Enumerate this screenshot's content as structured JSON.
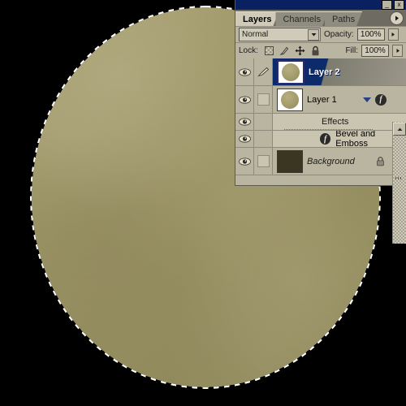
{
  "window": {
    "minimize_label": "_",
    "close_label": "x"
  },
  "palette": {
    "tabs": [
      {
        "label": "Layers",
        "active": true
      },
      {
        "label": "Channels",
        "active": false
      },
      {
        "label": "Paths",
        "active": false
      }
    ],
    "menu_icon": "palette-menu-arrow-icon",
    "blend_mode": {
      "value": "Normal",
      "dropdown_icon": "chevron-down-icon"
    },
    "opacity": {
      "label": "Opacity:",
      "value": "100%",
      "spinner_icon": "spinner-arrow-icon"
    },
    "fill": {
      "label": "Fill:",
      "value": "100%",
      "spinner_icon": "spinner-arrow-icon"
    },
    "lock": {
      "label": "Lock:",
      "icons": [
        "lock-transparent-pixels-icon",
        "lock-image-pixels-icon",
        "lock-position-icon",
        "lock-all-icon"
      ]
    },
    "layers": [
      {
        "name": "Layer 2",
        "selected": true,
        "visible": true,
        "visibility_icon": "eye-icon",
        "link_icon": "brush-icon",
        "thumbnail": "khaki-circle-thumbnail",
        "has_effects": false
      },
      {
        "name": "Layer 1",
        "selected": false,
        "visible": true,
        "visibility_icon": "eye-icon",
        "link_icon": "empty-link-box-icon",
        "thumbnail": "khaki-circle-thumbnail",
        "has_effects": true,
        "expand_icon": "expand-triangle-icon",
        "effects_icon": "layer-style-fx-icon"
      }
    ],
    "effects": {
      "header": "Effects",
      "items": [
        {
          "name": "Bevel and Emboss",
          "icon": "layer-style-fx-icon",
          "visibility_icon": "eye-icon"
        }
      ],
      "header_visibility_icon": "eye-icon"
    },
    "background_layer": {
      "name": "Background",
      "visible": true,
      "visibility_icon": "eye-icon",
      "link_icon": "empty-link-box-icon",
      "thumbnail": "dark-brown-thumbnail",
      "lock_icon": "lock-icon"
    },
    "scrollbar": {
      "up_icon": "scroll-up-icon"
    }
  },
  "canvas": {
    "shape": "circle-with-selection-marquee",
    "selection_indicator": "marching-ants-selection",
    "background_color": "#000000",
    "fill_color": "#9b9466"
  },
  "colors": {
    "palette_bg": "#b9b5a0",
    "selected_row": "#0d2a6b",
    "titlebar": "#0a2161",
    "khaki": "#9b9466",
    "dark_thumb": "#3b3622"
  }
}
